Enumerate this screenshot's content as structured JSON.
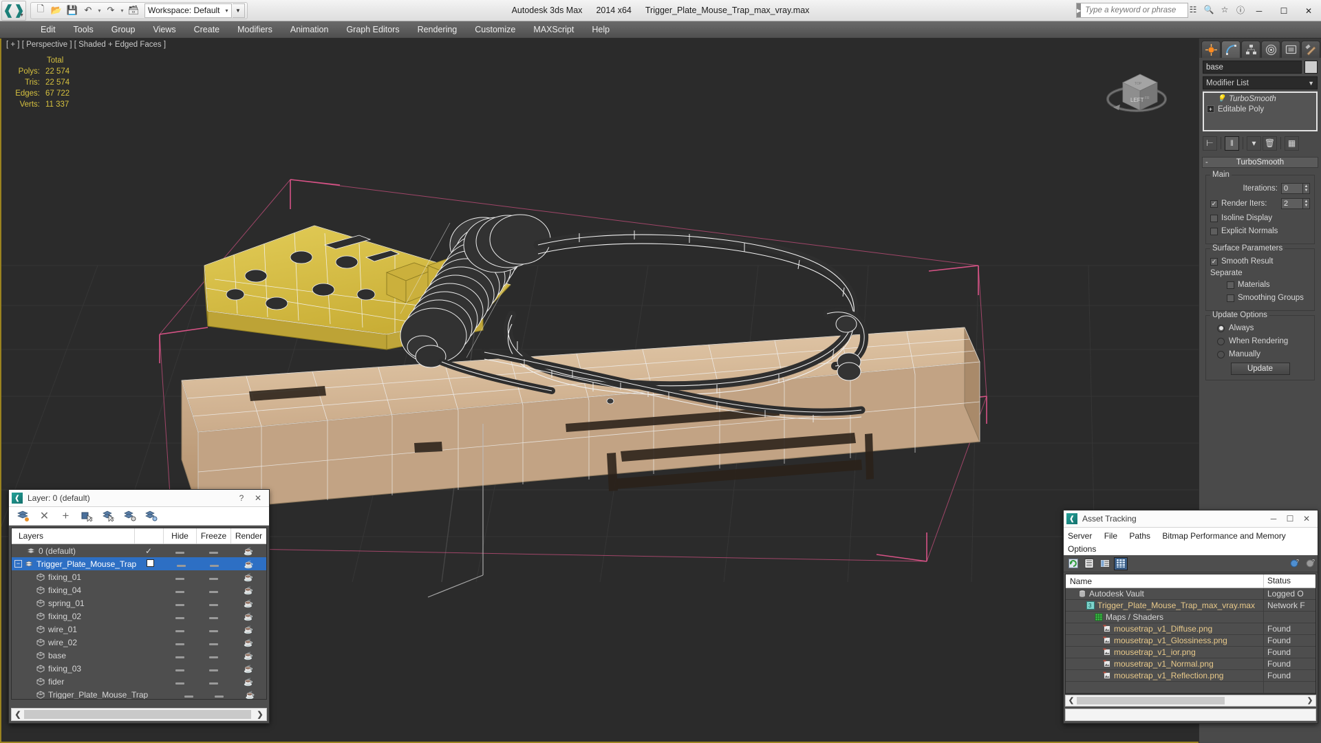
{
  "app": {
    "title": "Autodesk 3ds Max",
    "version": "2014 x64",
    "file": "Trigger_Plate_Mouse_Trap_max_vray.max"
  },
  "quick_access": {
    "workspace_label": "Workspace: Default",
    "buttons": [
      "new-icon",
      "open-icon",
      "save-icon",
      "undo-icon",
      "redo-icon",
      "set-project-icon"
    ]
  },
  "search": {
    "placeholder": "Type a keyword or phrase",
    "value": ""
  },
  "window_buttons": {
    "minimize": "─",
    "maximize": "☐",
    "close": "✕"
  },
  "menubar": {
    "items": [
      "Edit",
      "Tools",
      "Group",
      "Views",
      "Create",
      "Modifiers",
      "Animation",
      "Graph Editors",
      "Rendering",
      "Customize",
      "MAXScript",
      "Help"
    ]
  },
  "viewport": {
    "label": "[ + ] [ Perspective ] [ Shaded + Edged Faces ]",
    "stats_header": "Total",
    "stats": [
      {
        "key": "Polys:",
        "value": "22 574"
      },
      {
        "key": "Tris:",
        "value": "22 574"
      },
      {
        "key": "Edges:",
        "value": "67 722"
      },
      {
        "key": "Verts:",
        "value": "11 337"
      }
    ],
    "navcube_faces": {
      "front": "LEFT",
      "top": "TOP",
      "side": "FRONT"
    }
  },
  "command_panel": {
    "tabs": [
      "create-tab",
      "modify-tab",
      "hierarchy-tab",
      "motion-tab",
      "display-tab",
      "utilities-tab"
    ],
    "active_tab_index": 1,
    "object_name": "base",
    "object_color": "#cdcdcd",
    "modifier_list_label": "Modifier List",
    "stack": [
      {
        "label": "TurboSmooth",
        "italic": true,
        "icon": "lightbulb-icon"
      },
      {
        "label": "Editable Poly",
        "italic": false,
        "icon": "expand-icon"
      }
    ],
    "stack_buttons": [
      "pin-stack-icon",
      "show-end-result-icon",
      "make-unique-icon",
      "remove-modifier-icon",
      "configure-sets-icon"
    ],
    "rollout": {
      "title": "TurboSmooth",
      "collapse_glyph": "-",
      "groups": [
        {
          "title": "Main",
          "fields": [
            {
              "type": "spinner",
              "label": "Iterations:",
              "value": "0",
              "checkbox": null
            },
            {
              "type": "spinner",
              "label": "Render Iters:",
              "value": "2",
              "checkbox": true
            }
          ],
          "checks": [
            {
              "label": "Isoline Display",
              "checked": false
            },
            {
              "label": "Explicit Normals",
              "checked": false
            }
          ]
        },
        {
          "title": "Surface Parameters",
          "checks": [
            {
              "label": "Smooth Result",
              "checked": true,
              "indent": 0
            }
          ],
          "subtitle": "Separate",
          "subchecks": [
            {
              "label": "Materials",
              "checked": false
            },
            {
              "label": "Smoothing Groups",
              "checked": false
            }
          ]
        },
        {
          "title": "Update Options",
          "radios": [
            {
              "label": "Always",
              "selected": true
            },
            {
              "label": "When Rendering",
              "selected": false
            },
            {
              "label": "Manually",
              "selected": false
            }
          ],
          "button": "Update"
        }
      ]
    }
  },
  "layer_dialog": {
    "title": "Layer: 0 (default)",
    "help_glyph": "?",
    "close_glyph": "✕",
    "toolbar": [
      "new-layer-icon",
      "delete-layer-icon",
      "add-layer-icon",
      "select-objects-icon",
      "select-highlighted-icon",
      "highlight-selected-icon",
      "layer-properties-icon"
    ],
    "columns": [
      "Layers",
      "",
      "Hide",
      "Freeze",
      "Render"
    ],
    "rows": [
      {
        "name": "0 (default)",
        "indent": 1,
        "icon": "layer-icon",
        "mark": "✓",
        "selected": false
      },
      {
        "name": "Trigger_Plate_Mouse_Trap",
        "indent": 0,
        "icon": "layer-icon",
        "mark": "box",
        "selected": true,
        "expander": "-"
      },
      {
        "name": "fixing_01",
        "indent": 2,
        "icon": "object-icon",
        "mark": "",
        "selected": false
      },
      {
        "name": "fixing_04",
        "indent": 2,
        "icon": "object-icon",
        "mark": "",
        "selected": false
      },
      {
        "name": "spring_01",
        "indent": 2,
        "icon": "object-icon",
        "mark": "",
        "selected": false
      },
      {
        "name": "fixing_02",
        "indent": 2,
        "icon": "object-icon",
        "mark": "",
        "selected": false
      },
      {
        "name": "wire_01",
        "indent": 2,
        "icon": "object-icon",
        "mark": "",
        "selected": false
      },
      {
        "name": "wire_02",
        "indent": 2,
        "icon": "object-icon",
        "mark": "",
        "selected": false
      },
      {
        "name": "base",
        "indent": 2,
        "icon": "object-icon",
        "mark": "",
        "selected": false
      },
      {
        "name": "fixing_03",
        "indent": 2,
        "icon": "object-icon",
        "mark": "",
        "selected": false
      },
      {
        "name": "fider",
        "indent": 2,
        "icon": "object-icon",
        "mark": "",
        "selected": false
      },
      {
        "name": "Trigger_Plate_Mouse_Trap",
        "indent": 2,
        "icon": "object-icon",
        "mark": "",
        "selected": false
      }
    ],
    "scroll_left": "❮",
    "scroll_right": "❯"
  },
  "asset_dialog": {
    "title": "Asset Tracking",
    "window_buttons": {
      "minimize": "─",
      "maximize": "☐",
      "close": "✕"
    },
    "menu": [
      "Server",
      "File",
      "Paths",
      "Bitmap Performance and Memory",
      "Options"
    ],
    "toolbar": [
      "refresh-icon",
      "list-view-icon",
      "detail-view-icon",
      "grid-view-icon"
    ],
    "toolbar_right": [
      "add-vault-icon",
      "vault-help-icon"
    ],
    "active_tool_index": 3,
    "columns": [
      "Name",
      "Status"
    ],
    "rows": [
      {
        "name": "Autodesk Vault",
        "status": "Logged O",
        "indent": 0,
        "icon": "vault-icon",
        "color": "#d7d7d7"
      },
      {
        "name": "Trigger_Plate_Mouse_Trap_max_vray.max",
        "status": "Network F",
        "indent": 1,
        "icon": "max-file-icon",
        "color": "#e8c98a"
      },
      {
        "name": "Maps / Shaders",
        "status": "",
        "indent": 2,
        "icon": "maps-icon",
        "color": "#d7d7d7"
      },
      {
        "name": "mousetrap_v1_Diffuse.png",
        "status": "Found",
        "indent": 3,
        "icon": "bitmap-icon",
        "color": "#e8c98a"
      },
      {
        "name": "mousetrap_v1_Glossiness.png",
        "status": "Found",
        "indent": 3,
        "icon": "bitmap-icon",
        "color": "#e8c98a"
      },
      {
        "name": "mousetrap_v1_ior.png",
        "status": "Found",
        "indent": 3,
        "icon": "bitmap-icon",
        "color": "#e8c98a"
      },
      {
        "name": "mousetrap_v1_Normal.png",
        "status": "Found",
        "indent": 3,
        "icon": "bitmap-icon",
        "color": "#e8c98a"
      },
      {
        "name": "mousetrap_v1_Reflection.png",
        "status": "Found",
        "indent": 3,
        "icon": "bitmap-icon",
        "color": "#e8c98a"
      }
    ],
    "scroll_left": "❮",
    "scroll_right": "❯"
  },
  "colors": {
    "viewport_bg": "#2b2b2b",
    "accent_yellow": "#d6c13f",
    "selection_blue": "#2d6fc4",
    "panel_gray": "#4a4a4a",
    "trigger_plate_yellow": "#d8c14a",
    "wood_base": "#d8bfa0",
    "gizmo_pink": "#e05a8a"
  }
}
